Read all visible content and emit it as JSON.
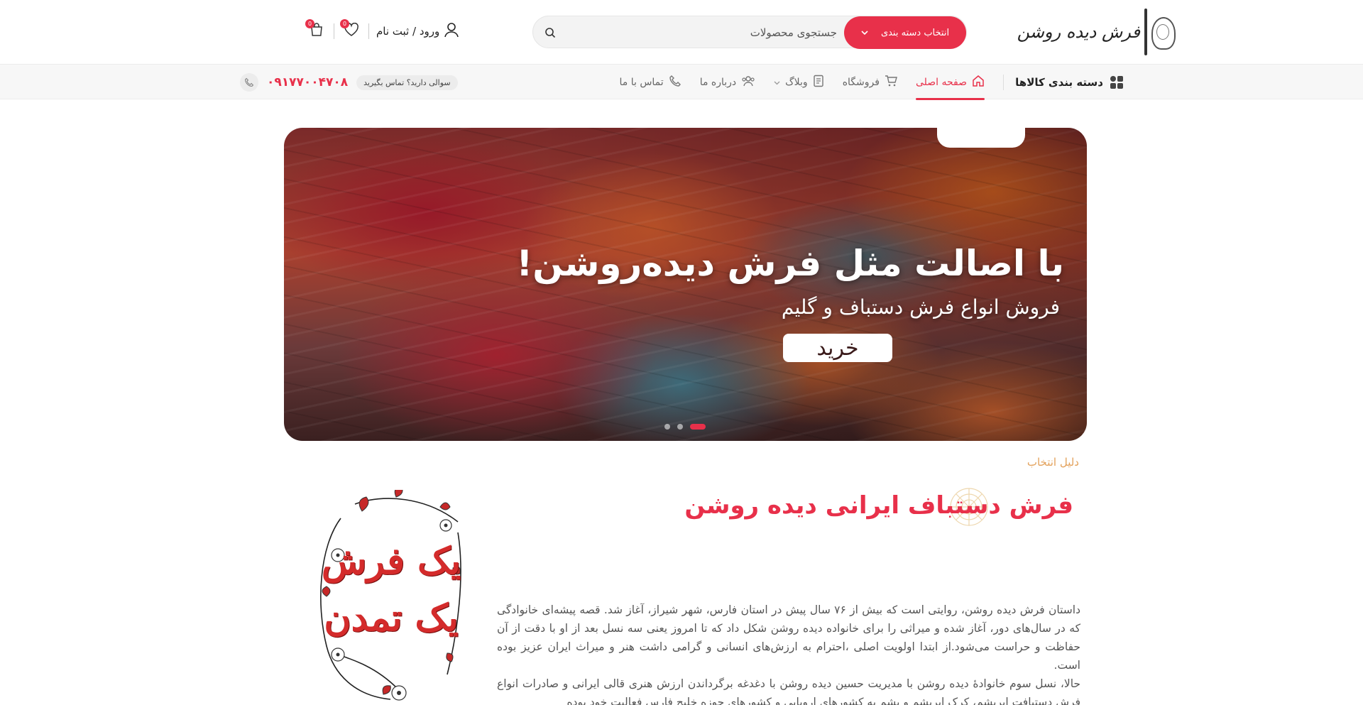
{
  "header": {
    "logo_text": "فرش دیده روشن",
    "search": {
      "category_label": "انتخاب دسته بندی",
      "placeholder": "جستجوی محصولات"
    },
    "account_label": "ورود / ثبت نام",
    "wishlist_count": "0",
    "cart_count": "0"
  },
  "navbar": {
    "categories_label": "دسته بندی کالاها",
    "links": [
      {
        "label": "صفحه اصلی",
        "icon": "home-icon",
        "active": true
      },
      {
        "label": "فروشگاه",
        "icon": "cart-icon",
        "active": false
      },
      {
        "label": "وبلاگ",
        "icon": "blog-icon",
        "active": false
      },
      {
        "label": "درباره ما",
        "icon": "users-icon",
        "active": false
      },
      {
        "label": "تماس با ما",
        "icon": "phone-icon",
        "active": false
      }
    ],
    "support_label": "سوالی دارید؟ تماس بگیرید",
    "support_number": "۰۹۱۷۷۰۰۴۷۰۸"
  },
  "hero": {
    "title": "با اصالت مثل فرش دیده‌روشن!",
    "subtitle": "فروش انواع فرش دستباف و گلیم",
    "button_label": "خرید",
    "slides_count": 3,
    "active_slide": 3
  },
  "intro": {
    "eyebrow": "دلیل انتخاب",
    "title": "فرش دستباف ایرانی دیده روشن",
    "paragraphs": [
      "داستان فرش دیده روشن، روایتی است که بیش از ۷۶ سال پیش در استان فارس، شهر شیراز، آغاز شد. قصه پیشه‌ای خانوادگی که در سال‌های دور، آغاز شده و میراثی را برای خانواده دیده روشن شکل داد که تا امروز یعنی سه نسل بعد از او با دقت از آن حفاظت و حراست می‌شود.از ابتدا اولویت اصلی ،احترام به ارزش‌های انسانی و گرامی داشت هنر و میراث ایران عزیز بوده است.",
      "حالا، نسل سوم خانوادهٔ دیده روشن با مدیریت حسین دیده روشن با دغدغه برگرداندن ارزش هنری قالی ایرانی و صادرات انواع فرش دستبافت ابریشم، کرک ابریشم و پشم به کشورهای اروپایی و کشورهای حوزه خلیج فارس فعالیت خود بوده"
    ],
    "calligraphy_line1": "یک فرش",
    "calligraphy_line2": "یک تمدن"
  },
  "colors": {
    "accent": "#e8304a",
    "eyebrow": "#e3a15a"
  }
}
